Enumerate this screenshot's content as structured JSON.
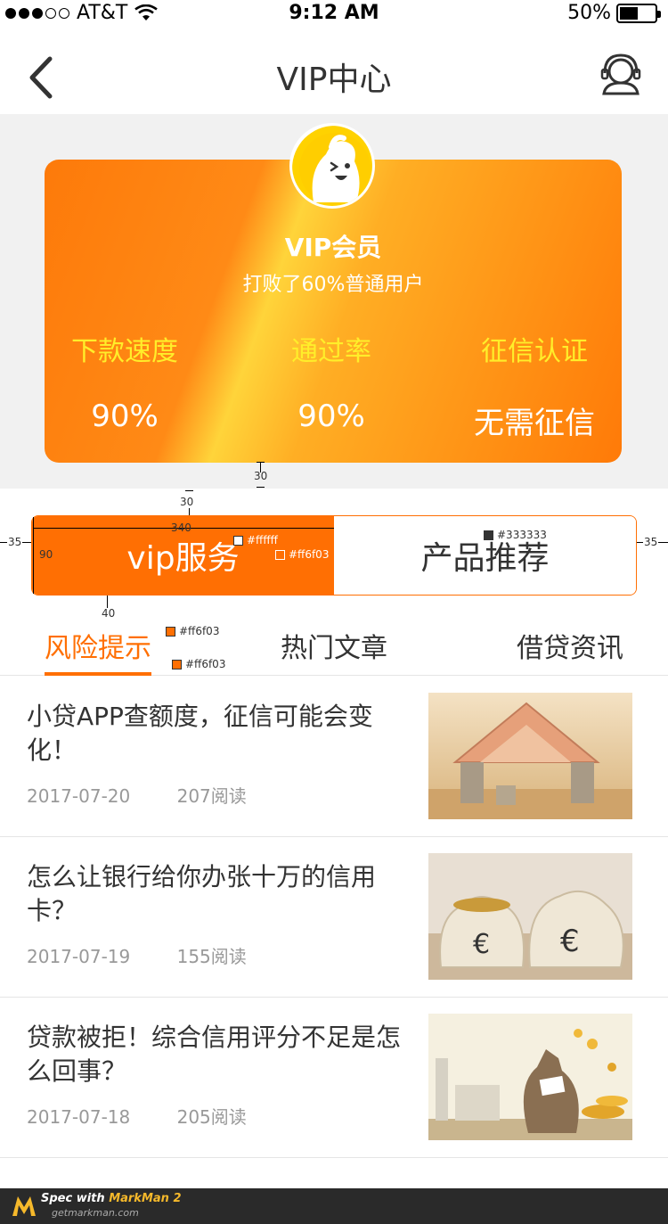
{
  "status_bar": {
    "carrier": "AT&T",
    "time": "9:12 AM",
    "battery": "50%"
  },
  "nav": {
    "title": "VIP中心",
    "back_icon": "chevron-left-icon",
    "support_icon": "customer-service-icon"
  },
  "vip_card": {
    "title": "VIP会员",
    "subtitle": "打败了60%普通用户",
    "stats": [
      {
        "label": "下款速度",
        "value": "90%"
      },
      {
        "label": "通过率",
        "value": "90%"
      },
      {
        "label": "征信认证",
        "value": "无需征信"
      }
    ]
  },
  "specs": {
    "gap_top": "30",
    "gap_bottom": "30",
    "width": "340",
    "height": "90",
    "side_left": "35",
    "side_right": "35",
    "tab_gap": "40",
    "color_white": "#ffffff",
    "color_orange_1": "#ff6f03",
    "color_text": "#333333",
    "color_orange_2": "#ff6f03",
    "color_orange_3": "#ff6f03"
  },
  "segment": {
    "active": "vip服务",
    "inactive": "产品推荐"
  },
  "tabs": [
    "风险提示",
    "热门文章",
    "借贷资讯"
  ],
  "articles": [
    {
      "title": "小贷APP查额度，征信可能会变化！",
      "date": "2017-07-20",
      "reads": "207阅读"
    },
    {
      "title": "怎么让银行给你办张十万的信用卡？",
      "date": "2017-07-19",
      "reads": "155阅读"
    },
    {
      "title": "贷款被拒！综合信用评分不足是怎么回事？",
      "date": "2017-07-18",
      "reads": "205阅读"
    }
  ],
  "footer": {
    "brand_prefix": "Spec with ",
    "brand": "MarkMan 2",
    "url": "getmarkman.com"
  },
  "colors": {
    "accent": "#ff6f03",
    "text": "#333333",
    "meta": "#999999",
    "stat_label": "#ffee2a"
  }
}
